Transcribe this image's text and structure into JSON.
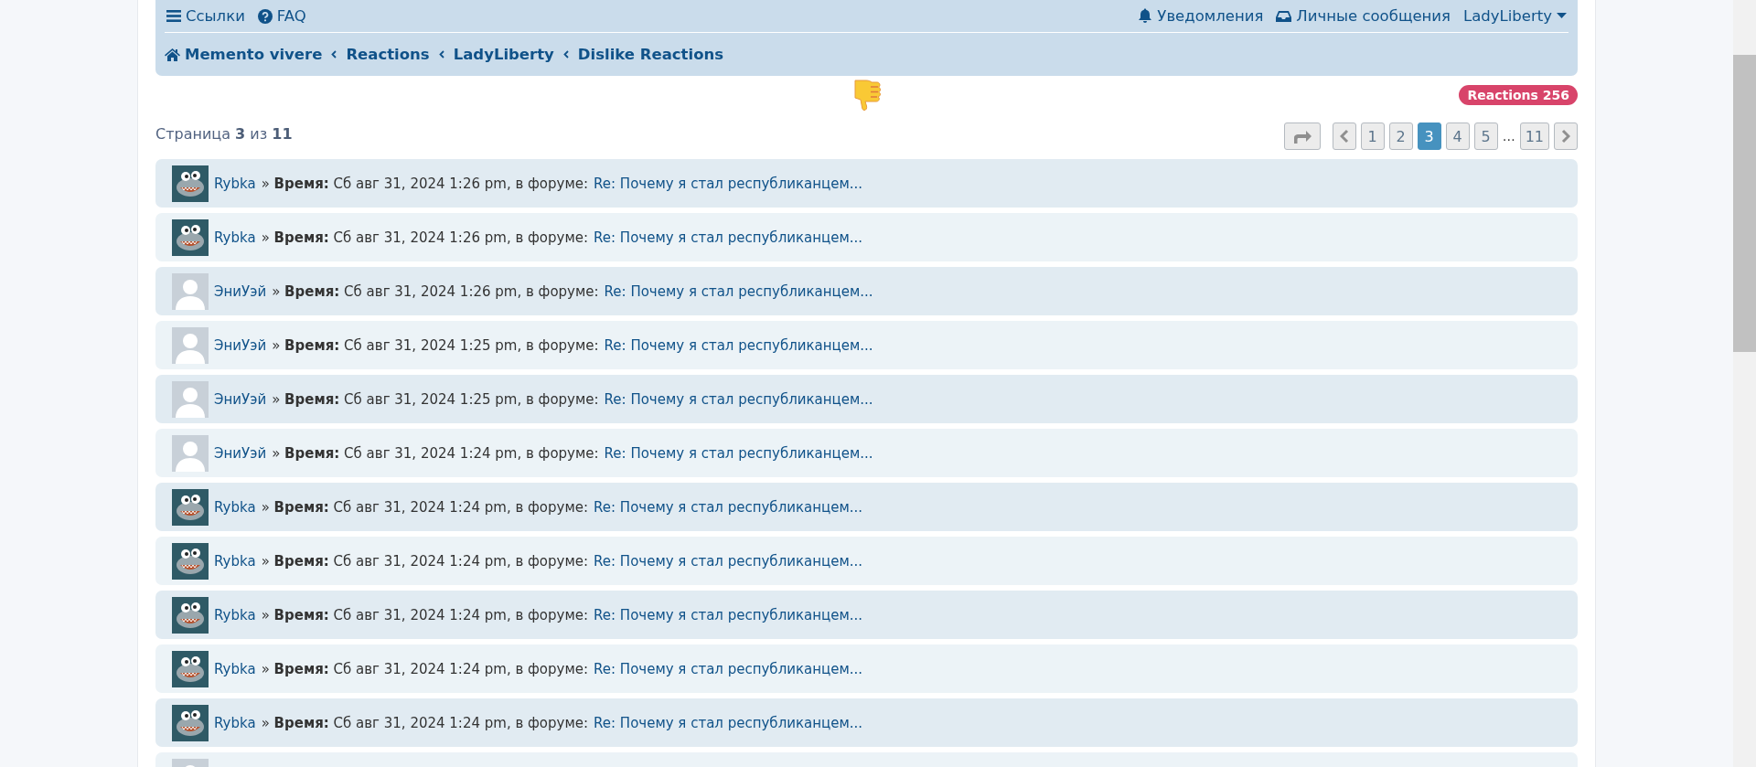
{
  "nav": {
    "links": [
      {
        "label": "Ссылки"
      },
      {
        "label": "FAQ"
      }
    ],
    "user_links": [
      {
        "label": "Уведомления"
      },
      {
        "label": "Личные сообщения"
      },
      {
        "label": "LadyLiberty"
      }
    ]
  },
  "breadcrumbs": [
    "Memento vivere",
    "Reactions",
    "LadyLiberty",
    "Dislike Reactions"
  ],
  "reactions_badge": "Reactions 256",
  "page_info": "Страница **3** из **11**",
  "pagination": [
    {
      "kind": "prev",
      "selected": false
    },
    {
      "kind": "page",
      "label": "1",
      "selected": false
    },
    {
      "kind": "page",
      "label": "2",
      "selected": false
    },
    {
      "kind": "page",
      "label": "3",
      "selected": true
    },
    {
      "kind": "page",
      "label": "4",
      "selected": false
    },
    {
      "kind": "page",
      "label": "5",
      "selected": false
    },
    {
      "kind": "ellipsis",
      "label": "…",
      "selected": false
    },
    {
      "kind": "page",
      "label": "11",
      "selected": false
    },
    {
      "kind": "next",
      "selected": false
    }
  ],
  "rows": [
    {
      "kind": "image",
      "user": "Rybka",
      "meta": "» **Время:** Сб авг 31, 2024 1:26 pm, в форуме:",
      "topic": "Re: Почему я стал республиканцем..."
    },
    {
      "kind": "image",
      "user": "Rybka",
      "meta": "» **Время:** Сб авг 31, 2024 1:26 pm, в форуме:",
      "topic": "Re: Почему я стал республиканцем..."
    },
    {
      "kind": "default",
      "user": "ЭниУэй",
      "meta": "» **Время:** Сб авг 31, 2024 1:26 pm, в форуме:",
      "topic": "Re: Почему я стал республиканцем..."
    },
    {
      "kind": "default",
      "user": "ЭниУэй",
      "meta": "» **Время:** Сб авг 31, 2024 1:25 pm, в форуме:",
      "topic": "Re: Почему я стал республиканцем..."
    },
    {
      "kind": "default",
      "user": "ЭниУэй",
      "meta": "» **Время:** Сб авг 31, 2024 1:25 pm, в форуме:",
      "topic": "Re: Почему я стал республиканцем..."
    },
    {
      "kind": "default",
      "user": "ЭниУэй",
      "meta": "» **Время:** Сб авг 31, 2024 1:24 pm, в форуме:",
      "topic": "Re: Почему я стал республиканцем..."
    },
    {
      "kind": "image",
      "user": "Rybka",
      "meta": "» **Время:** Сб авг 31, 2024 1:24 pm, в форуме:",
      "topic": "Re: Почему я стал республиканцем..."
    },
    {
      "kind": "image",
      "user": "Rybka",
      "meta": "» **Время:** Сб авг 31, 2024 1:24 pm, в форуме:",
      "topic": "Re: Почему я стал республиканцем..."
    },
    {
      "kind": "image",
      "user": "Rybka",
      "meta": "» **Время:** Сб авг 31, 2024 1:24 pm, в форуме:",
      "topic": "Re: Почему я стал республиканцем..."
    },
    {
      "kind": "image",
      "user": "Rybka",
      "meta": "» **Время:** Сб авг 31, 2024 1:24 pm, в форуме:",
      "topic": "Re: Почему я стал республиканцем..."
    },
    {
      "kind": "image",
      "user": "Rybka",
      "meta": "» **Время:** Сб авг 31, 2024 1:24 pm, в форуме:",
      "topic": "Re: Почему я стал республиканцем..."
    },
    {
      "kind": "default"
    }
  ]
}
